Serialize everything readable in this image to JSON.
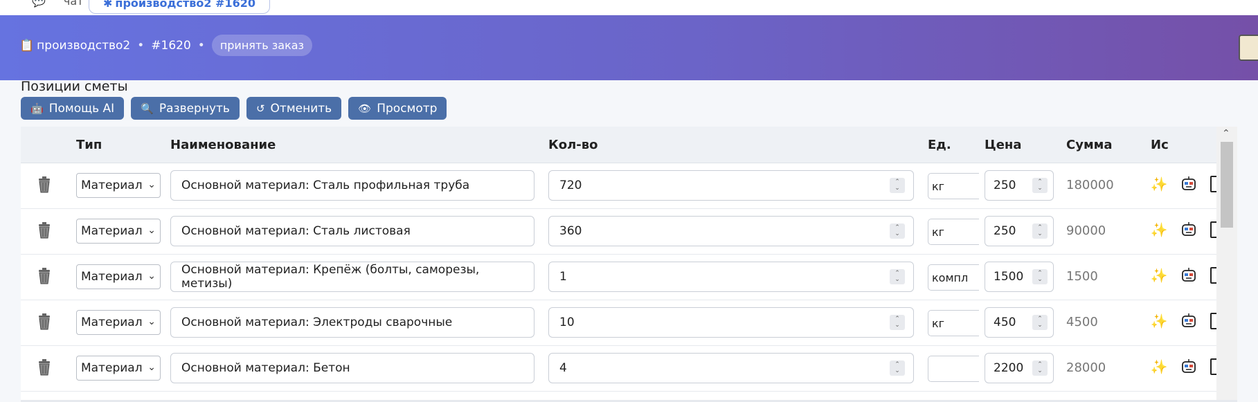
{
  "tabs": {
    "chat_label": "чат",
    "active_label": "производство2 #1620"
  },
  "header": {
    "crumb_icon": "clipboard-icon",
    "project": "производство2",
    "order_id": "#1620",
    "accept_label": "принять заказ"
  },
  "section": {
    "title": "Позиции сметы"
  },
  "toolbar": {
    "ai_help": "Помощь AI",
    "expand": "Развернуть",
    "undo": "Отменить",
    "preview": "Просмотр"
  },
  "columns": {
    "type": "Тип",
    "name": "Наименование",
    "qty": "Кол-во",
    "unit": "Ед.",
    "price": "Цена",
    "sum": "Сумма",
    "source": "Ис"
  },
  "rows": [
    {
      "type": "Материал",
      "name": "Основной материал: Сталь профильная труба",
      "qty": "720",
      "unit": "кг",
      "price": "250",
      "sum": "180000"
    },
    {
      "type": "Материал",
      "name": "Основной материал: Сталь листовая",
      "qty": "360",
      "unit": "кг",
      "price": "250",
      "sum": "90000"
    },
    {
      "type": "Материал",
      "name": "Основной материал: Крепёж (болты, саморезы, метизы)",
      "qty": "1",
      "unit": "компл",
      "price": "1500",
      "sum": "1500"
    },
    {
      "type": "Материал",
      "name": "Основной материал: Электроды сварочные",
      "qty": "10",
      "unit": "кг",
      "price": "450",
      "sum": "4500"
    },
    {
      "type": "Материал",
      "name": "Основной материал: Бетон",
      "qty": "4",
      "unit": "",
      "price": "2200",
      "sum": "28000"
    }
  ],
  "colors": {
    "header_start": "#6673e0",
    "header_end": "#7550a8",
    "button": "#4b6fa8",
    "star": "#e2c21a"
  }
}
